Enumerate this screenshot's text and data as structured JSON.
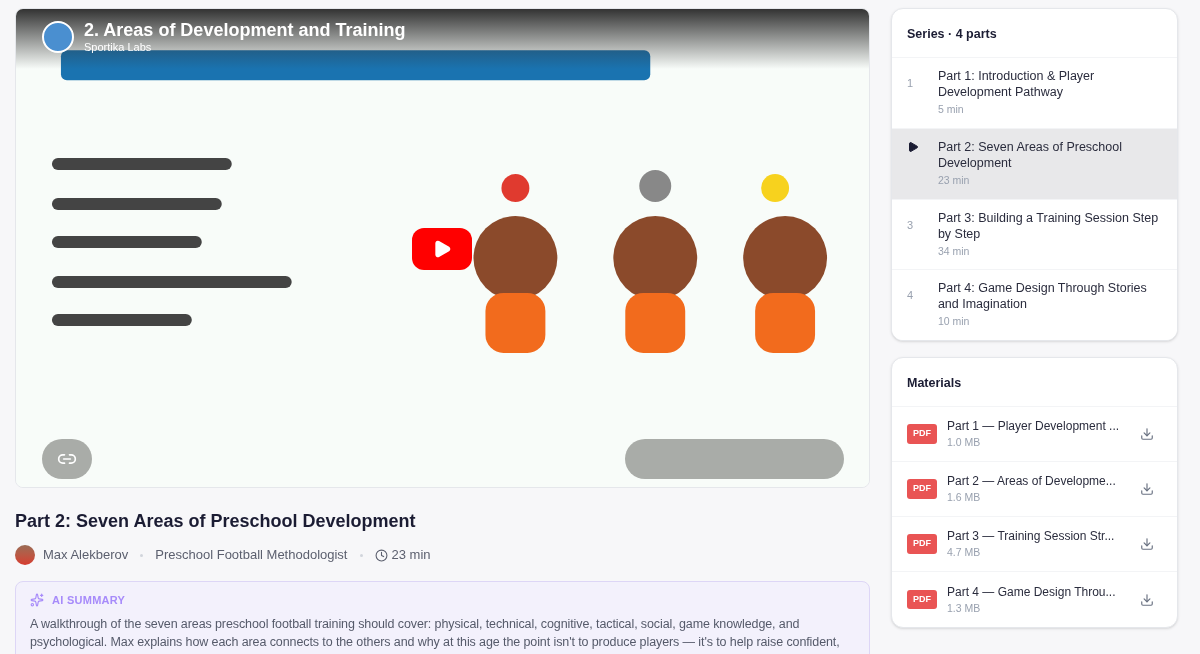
{
  "video": {
    "title": "2. Areas of Development and Training",
    "channel": "Sportika Labs",
    "kind": "picture"
  },
  "lesson": {
    "title": "Part 2: Seven Areas of Preschool Development",
    "author": "Max Alekberov",
    "role": "Preschool Football Methodologist",
    "duration": "23 min"
  },
  "summary": {
    "label": "AI SUMMARY",
    "text": "A walkthrough of the seven areas preschool football training should cover: physical, technical, cognitive, tactical, social, game knowledge, and psychological. Max explains how each area connects to the others and why at this age the point isn't to produce players — it's to help raise confident,"
  },
  "series": {
    "title": "Series · 4 parts",
    "parts": [
      {
        "number": "1",
        "title": "Part 1: Introduction & Player Development Pathway",
        "duration": "5 min",
        "selected": false
      },
      {
        "title": "Part 2: Seven Areas of Preschool Development",
        "duration": "23 min",
        "selected": true
      },
      {
        "number": "3",
        "title": "Part 3: Building a Training Session Step by Step",
        "duration": "34 min",
        "selected": false
      },
      {
        "number": "4",
        "title": "Part 4: Game Design Through Stories and Imagination",
        "duration": "10 min",
        "selected": false
      }
    ]
  },
  "materials": {
    "title": "Materials",
    "files": [
      {
        "badge": "PDF",
        "name": "Part 1 — Player Development ...",
        "size": "1.0 MB"
      },
      {
        "badge": "PDF",
        "name": "Part 2 — Areas of Developme...",
        "size": "1.6 MB"
      },
      {
        "badge": "PDF",
        "name": "Part 3 — Training Session Str...",
        "size": "4.7 MB"
      },
      {
        "badge": "PDF",
        "name": "Part 4 — Game Design Throu...",
        "size": "1.3 MB"
      }
    ]
  }
}
